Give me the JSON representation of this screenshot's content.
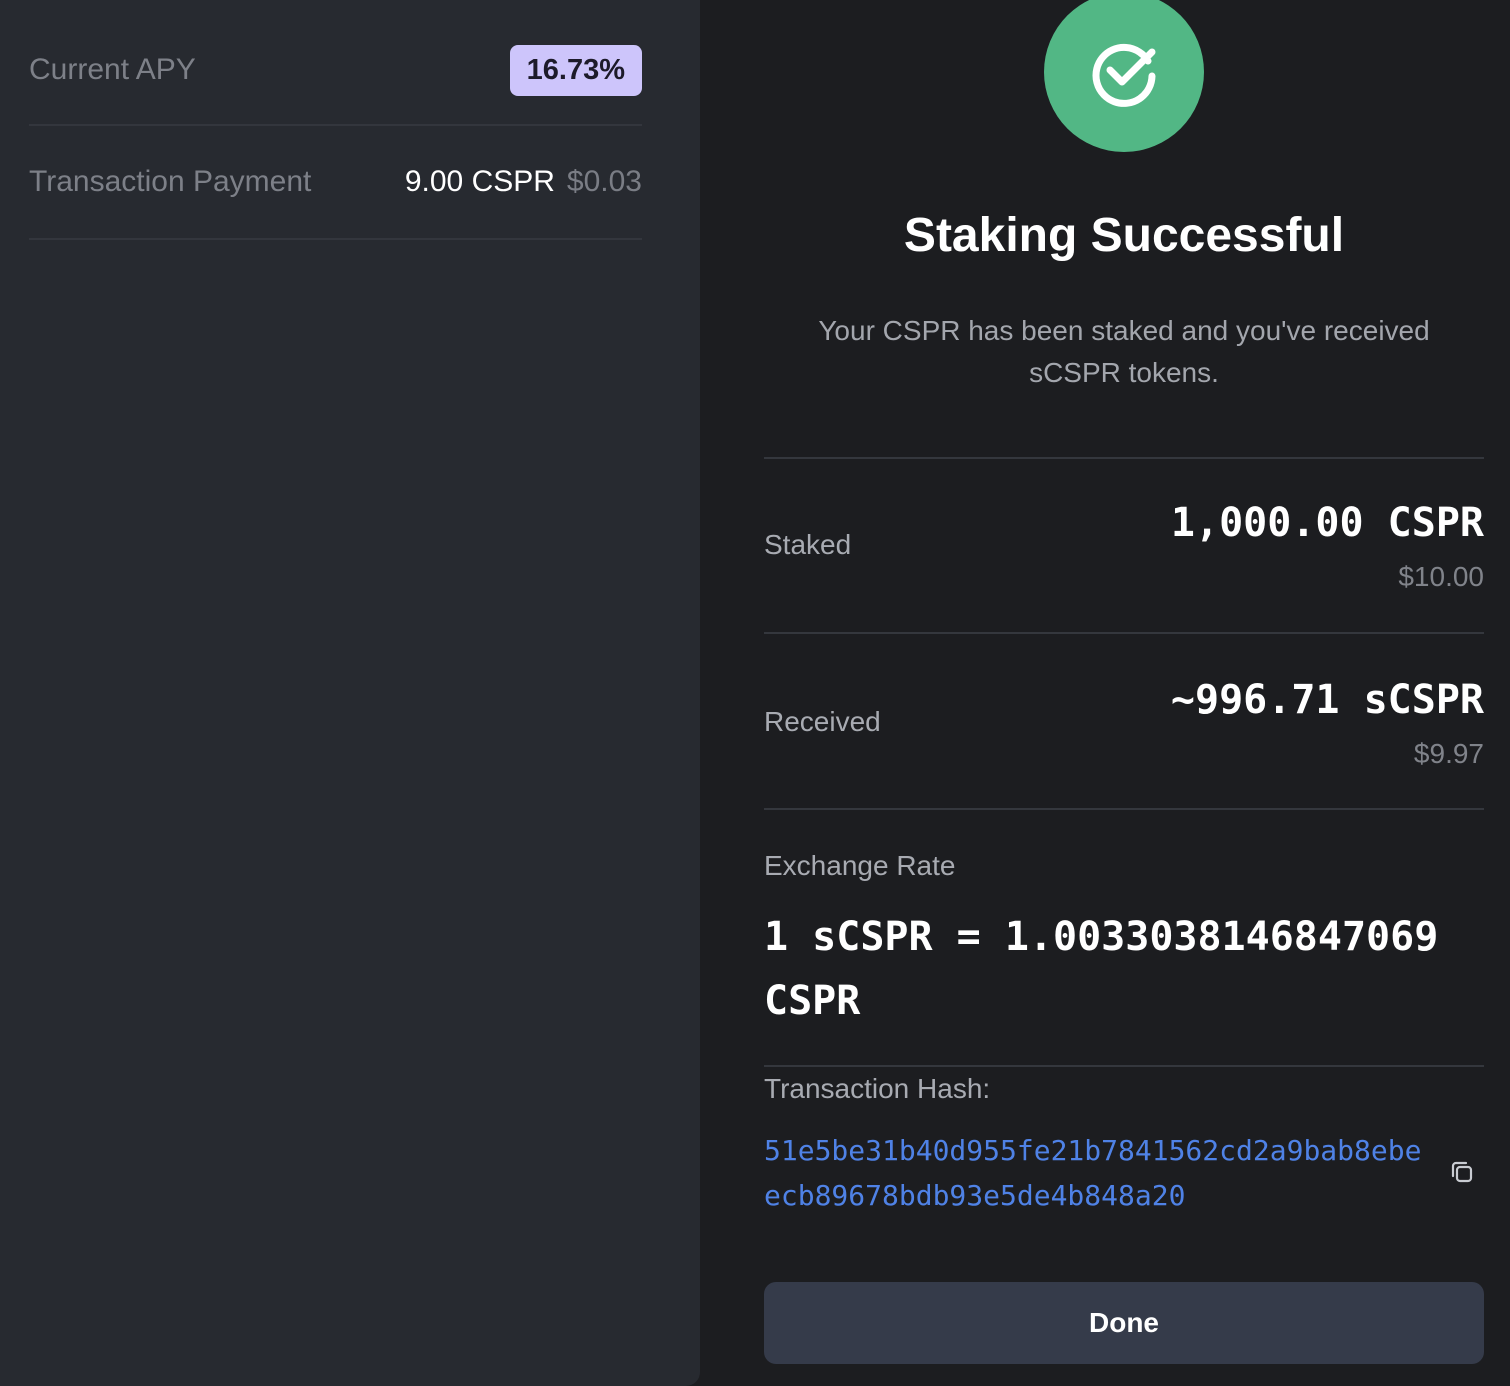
{
  "summary": {
    "apy_label": "Current APY",
    "apy_value": "16.73%",
    "payment_label": "Transaction Payment",
    "payment_amount": "9.00 CSPR",
    "payment_fiat": "$0.03"
  },
  "modal": {
    "icon": "check-circle-icon",
    "title": "Staking Successful",
    "subtitle": "Your CSPR has been staked and you've received sCSPR tokens.",
    "staked": {
      "label": "Staked",
      "value": "1,000.00 CSPR",
      "fiat": "$10.00"
    },
    "received": {
      "label": "Received",
      "value": "~996.71 sCSPR",
      "fiat": "$9.97"
    },
    "exchange_rate": {
      "label": "Exchange Rate",
      "value": "1 sCSPR = 1.0033038146847069 CSPR"
    },
    "transaction_hash": {
      "label": "Transaction Hash:",
      "value": "51e5be31b40d955fe21b7841562cd2a9bab8ebeecb89678bdb93e5de4b848a20",
      "copy_icon": "copy-icon"
    },
    "done_label": "Done"
  },
  "colors": {
    "success": "#52b785",
    "apy_badge": "#cdc5fb",
    "hash_link": "#4f82e6",
    "button": "#353b4a"
  }
}
